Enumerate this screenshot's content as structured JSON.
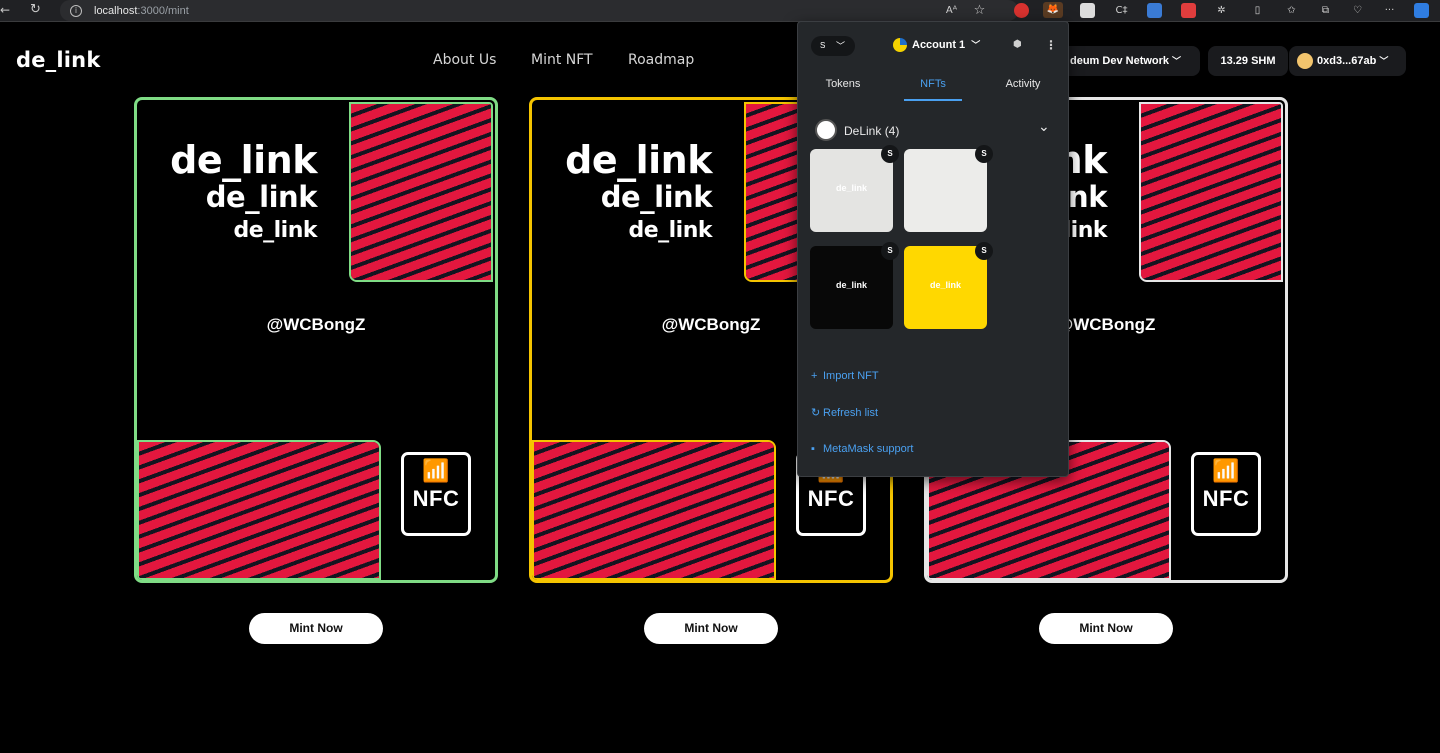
{
  "browser": {
    "url_host": "localhost",
    "url_path": ":3000/mint",
    "back_glyph": "←",
    "reload_glyph": "↻",
    "info_glyph": "i",
    "ext_read_aloud": "Aᴬ",
    "ext_star": "☆",
    "ext_c": "C‡",
    "ext_kebab": "···"
  },
  "site": {
    "logo": "de_link",
    "nav": [
      "About Us",
      "Mint NFT",
      "Roadmap"
    ],
    "network": "deum Dev Network",
    "balance": "13.29 SHM",
    "address": "0xd3...67ab"
  },
  "cards": [
    {
      "border_color": "#7fdc85",
      "title_lines": [
        "de_link",
        "de_link",
        "de_link"
      ],
      "handle": "@WCBongZ",
      "nfc_label": "NFC",
      "button": "Mint Now"
    },
    {
      "border_color": "#f5c400",
      "title_lines": [
        "de_link",
        "de_link",
        "de_link"
      ],
      "handle": "@WCBongZ",
      "nfc_label": "NFC",
      "button": "Mint Now"
    },
    {
      "border_color": "#e6e6e6",
      "title_lines": [
        "de_link",
        "de_link",
        "de_link"
      ],
      "handle": "@WCBongZ",
      "nfc_label": "NFC",
      "button": "Mint Now"
    }
  ],
  "metamask": {
    "network_label": "S",
    "account": "Account 1",
    "tabs": [
      "Tokens",
      "NFTs",
      "Activity"
    ],
    "active_tab": "NFTs",
    "collection": "DeLink (4)",
    "nfts": [
      {
        "badge": "S",
        "label": "de_link",
        "bg": "#e4e4e2",
        "fg": "#ffffff"
      },
      {
        "badge": "S",
        "label": "",
        "bg": "#ececea",
        "fg": "#cccccc"
      },
      {
        "badge": "S",
        "label": "de_link",
        "bg": "#080808",
        "fg": "#ffffff"
      },
      {
        "badge": "S",
        "label": "de_link",
        "bg": "#ffd800",
        "fg": "#ffffff"
      }
    ],
    "import_nft": "Import NFT",
    "refresh_list": "Refresh list",
    "support": "MetaMask support"
  }
}
